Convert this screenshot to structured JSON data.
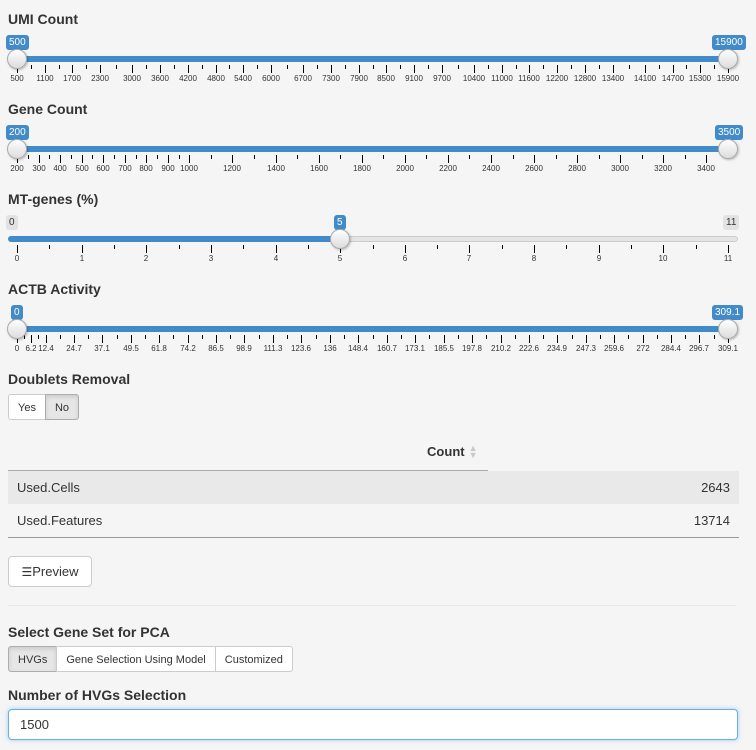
{
  "sliders": [
    {
      "id": "umi",
      "label": "UMI Count",
      "min": 500,
      "max": 15900,
      "from": 500,
      "to": 15900,
      "from_label": "500",
      "to_label": "15900",
      "range": true,
      "tick_labels": [
        "500",
        "1100",
        "1700",
        "2300",
        "3000",
        "3600",
        "4200",
        "4800",
        "5400",
        "6000",
        "6700",
        "7300",
        "7900",
        "8500",
        "9100",
        "9700",
        "10400",
        "11000",
        "11600",
        "12200",
        "12800",
        "13400",
        "14100",
        "14700",
        "15300",
        "15900"
      ]
    },
    {
      "id": "gene",
      "label": "Gene Count",
      "min": 200,
      "max": 3500,
      "from": 200,
      "to": 3500,
      "from_label": "200",
      "to_label": "3500",
      "range": true,
      "tick_labels": [
        "200",
        "300",
        "400",
        "500",
        "600",
        "700",
        "800",
        "900",
        "1000",
        "1200",
        "1400",
        "1600",
        "1800",
        "2000",
        "2200",
        "2400",
        "2600",
        "2800",
        "3000",
        "3200",
        "3400"
      ]
    },
    {
      "id": "mt",
      "label": "MT-genes (%)",
      "min": 0,
      "max": 11,
      "value": 5,
      "value_label": "5",
      "min_label": "0",
      "max_label": "11",
      "range": false,
      "tick_labels": [
        "0",
        "1",
        "2",
        "3",
        "4",
        "5",
        "6",
        "7",
        "8",
        "9",
        "10",
        "11"
      ]
    },
    {
      "id": "actb",
      "label": "ACTB Activity",
      "min": 0,
      "max": 309.1,
      "from": 0,
      "to": 309.1,
      "from_label": "0",
      "to_label": "309.1",
      "range": true,
      "tick_labels": [
        "0",
        "6.2",
        "12.4",
        "24.7",
        "37.1",
        "49.5",
        "61.8",
        "74.2",
        "86.5",
        "98.9",
        "111.3",
        "123.6",
        "136",
        "148.4",
        "160.7",
        "173.1",
        "185.5",
        "197.8",
        "210.2",
        "222.6",
        "234.9",
        "247.3",
        "259.6",
        "272",
        "284.4",
        "296.7",
        "309.1"
      ]
    }
  ],
  "doublets": {
    "label": "Doublets Removal",
    "options": [
      "Yes",
      "No"
    ],
    "selected": "No"
  },
  "table": {
    "header": "Count",
    "rows": [
      {
        "name": "Used.Cells",
        "count": "2643"
      },
      {
        "name": "Used.Features",
        "count": "13714"
      }
    ]
  },
  "preview": {
    "icon": "list-check-icon",
    "label": "Preview"
  },
  "gene_set": {
    "label": "Select Gene Set for PCA",
    "options": [
      "HVGs",
      "Gene Selection Using Model",
      "Customized"
    ],
    "selected": "HVGs"
  },
  "hvg": {
    "label": "Number of HVGs Selection",
    "value": "1500"
  },
  "colors": {
    "accent": "#428bca",
    "background": "#f5f5f5"
  }
}
